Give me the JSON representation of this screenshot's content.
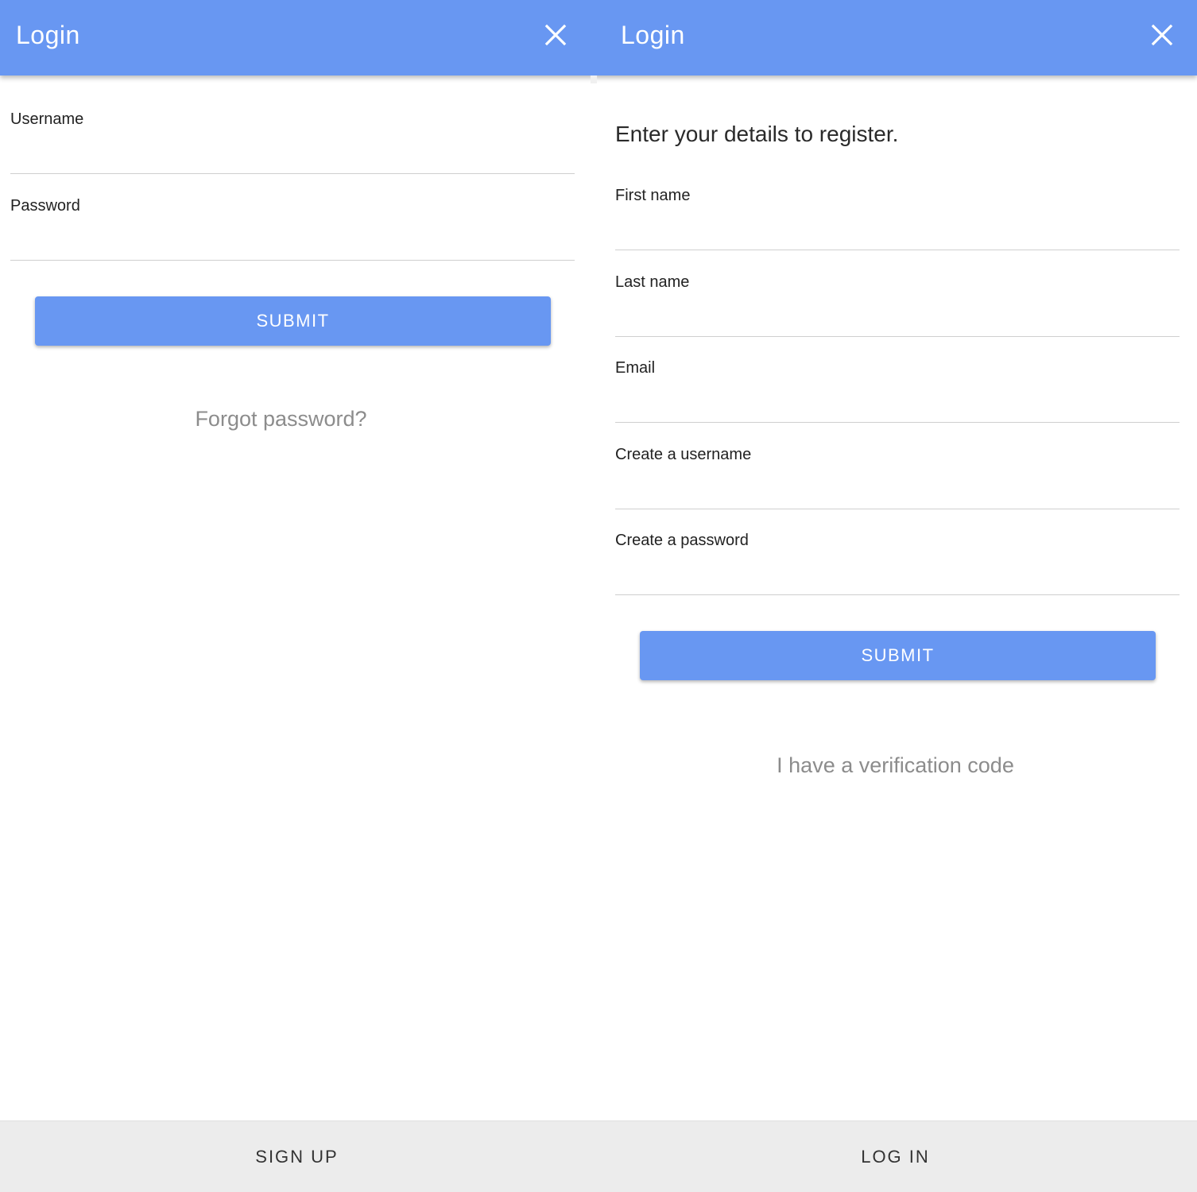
{
  "colors": {
    "primary": "#6897f2",
    "footer": "#ececec",
    "link": "#8c8c8c"
  },
  "login_screen": {
    "title": "Login",
    "close_icon": "close-icon",
    "fields": [
      {
        "label": "Username",
        "value": ""
      },
      {
        "label": "Password",
        "value": ""
      }
    ],
    "submit_label": "SUBMIT",
    "forgot_link": "Forgot password?",
    "footer_button": "SIGN UP"
  },
  "register_screen": {
    "title": "Login",
    "close_icon": "close-icon",
    "heading": "Enter your details to register.",
    "fields": [
      {
        "label": "First name",
        "value": ""
      },
      {
        "label": "Last name",
        "value": ""
      },
      {
        "label": "Email",
        "value": ""
      },
      {
        "label": "Create a username",
        "value": ""
      },
      {
        "label": "Create a password",
        "value": ""
      }
    ],
    "submit_label": "SUBMIT",
    "verification_link": "I have a verification code",
    "footer_button": "LOG IN"
  }
}
